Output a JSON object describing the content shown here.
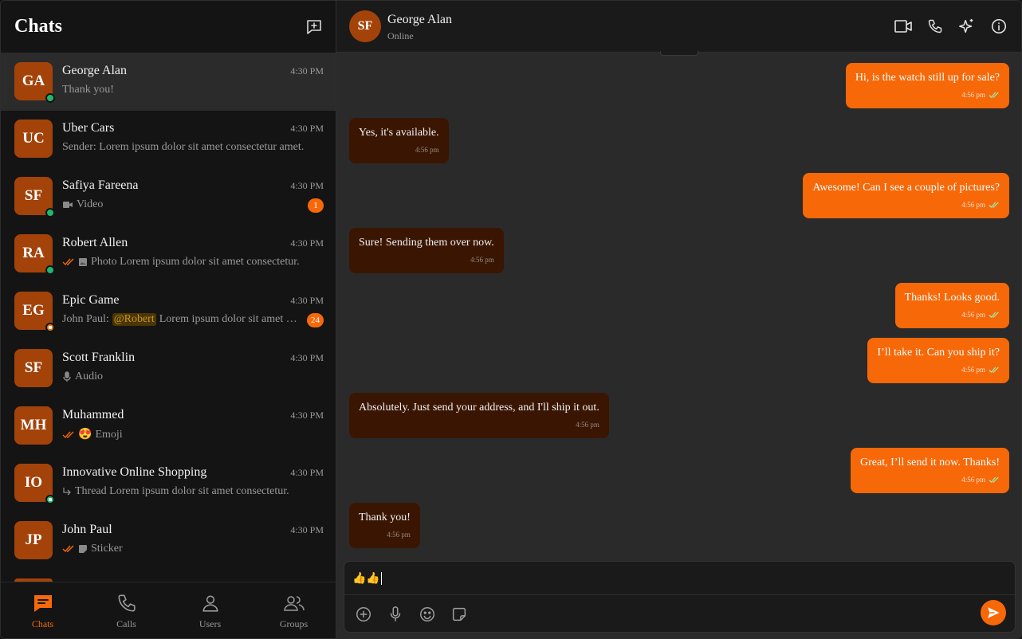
{
  "sidebar": {
    "title": "Chats",
    "chats": [
      {
        "initials": "GA",
        "name": "George Alan",
        "time": "4:30 PM",
        "preview": "Thank you!"
      },
      {
        "initials": "UC",
        "name": "Uber Cars",
        "time": "4:30 PM",
        "preview": "Sender: Lorem ipsum dolor sit amet consectetur amet."
      },
      {
        "initials": "SF",
        "name": "Safiya Fareena",
        "time": "4:30 PM",
        "preview": "Video",
        "badge": "1"
      },
      {
        "initials": "RA",
        "name": "Robert Allen",
        "time": "4:30 PM",
        "preview": "Photo Lorem ipsum dolor sit amet consectetur."
      },
      {
        "initials": "EG",
        "name": "Epic Game",
        "time": "4:30 PM",
        "sender": "John Paul:",
        "mention": "@Robert",
        "preview": "Lorem ipsum dolor sit amet consectetur.",
        "badge": "24"
      },
      {
        "initials": "SF",
        "name": "Scott Franklin",
        "time": "4:30 PM",
        "preview": "Audio"
      },
      {
        "initials": "MH",
        "name": "Muhammed",
        "time": "4:30 PM",
        "emoji": "😍",
        "preview": "Emoji"
      },
      {
        "initials": "IO",
        "name": "Innovative Online Shopping",
        "time": "4:30 PM",
        "preview": "Thread Lorem ipsum dolor sit amet consectetur."
      },
      {
        "initials": "JP",
        "name": "John Paul",
        "time": "4:30 PM",
        "preview": "Sticker"
      }
    ],
    "nav": {
      "chats": "Chats",
      "calls": "Calls",
      "users": "Users",
      "groups": "Groups"
    }
  },
  "conversation": {
    "avatar_initials": "SF",
    "name": "George Alan",
    "status": "Online",
    "messages": [
      {
        "dir": "out",
        "text": "Hi, is the watch still up for sale?",
        "time": "4:56 pm"
      },
      {
        "dir": "in",
        "text": "Yes, it's available.",
        "time": "4:56 pm"
      },
      {
        "dir": "out",
        "text": "Awesome! Can I see a couple of pictures?",
        "time": "4:56 pm"
      },
      {
        "dir": "in",
        "text": "Sure! Sending them over now.",
        "time": "4:56 pm"
      },
      {
        "dir": "out",
        "text": "Thanks! Looks good.",
        "time": "4:56 pm"
      },
      {
        "dir": "out",
        "text": "I’ll take it. Can you ship it?",
        "time": "4:56 pm"
      },
      {
        "dir": "in",
        "text": "Absolutely. Just send your address, and I'll ship it out.",
        "time": "4:56 pm"
      },
      {
        "dir": "out",
        "text": "Great, I’ll send it now. Thanks!",
        "time": "4:56 pm"
      },
      {
        "dir": "in",
        "text": "Thank you!",
        "time": "4:56 pm"
      }
    ],
    "composer": {
      "value": "👍👍"
    }
  },
  "colors": {
    "accent": "#f76808",
    "avatar": "#a3430a",
    "incoming_bubble": "#3a1602",
    "online": "#1fb86c"
  }
}
